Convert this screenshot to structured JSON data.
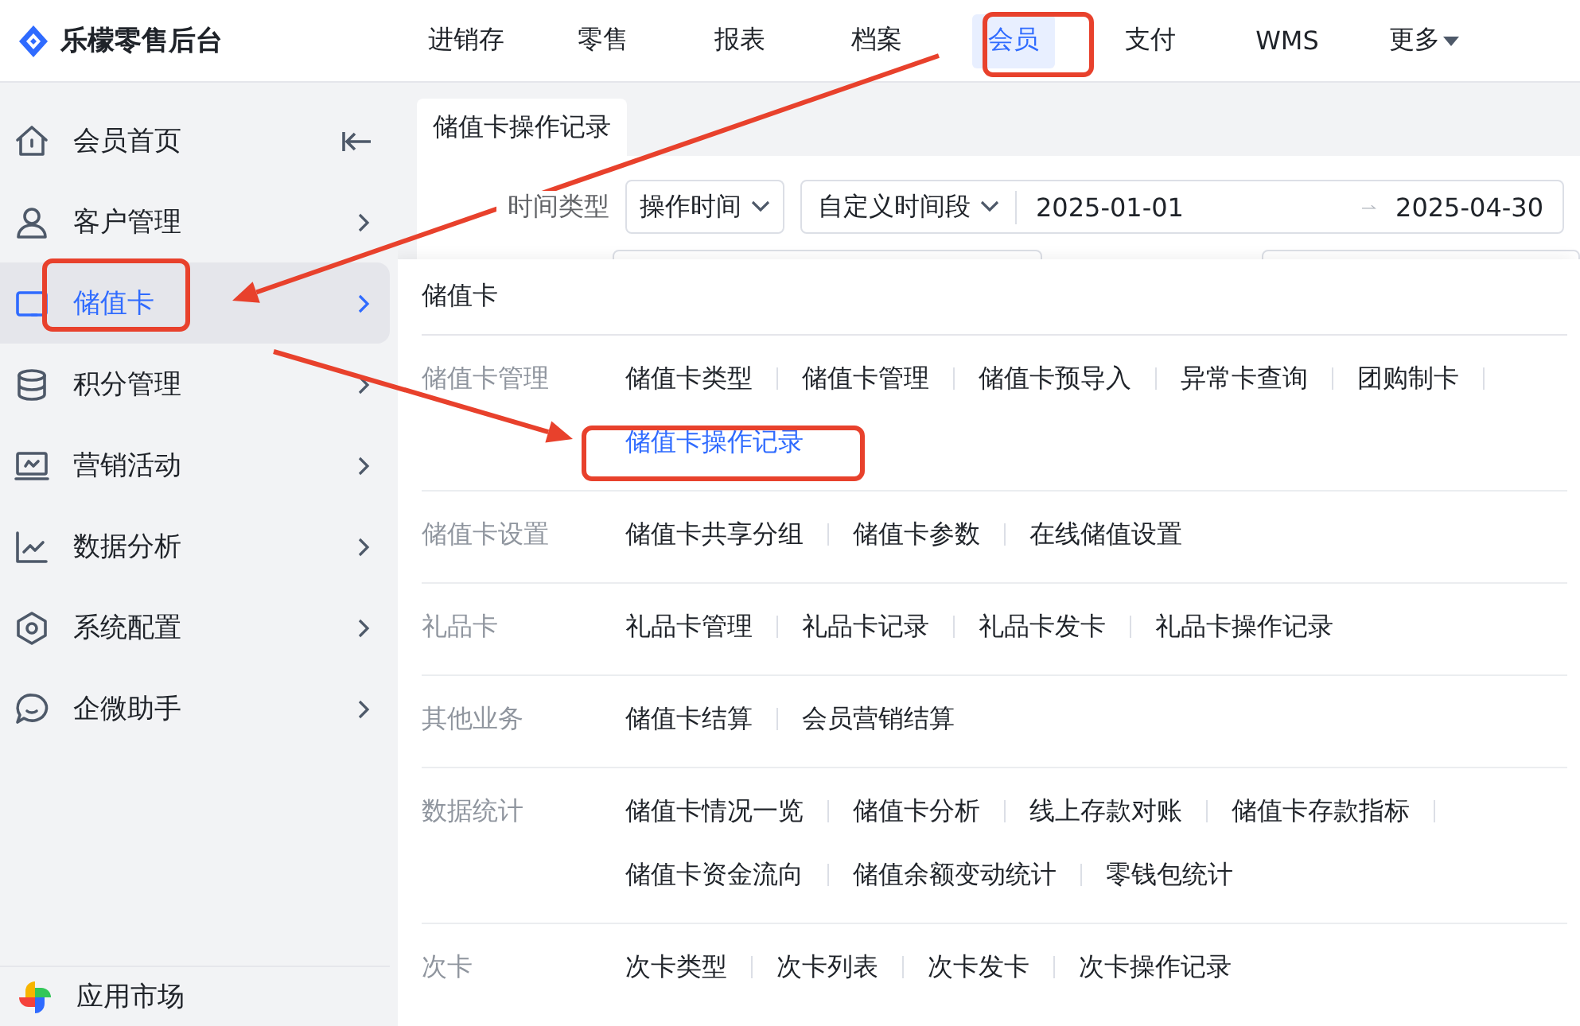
{
  "header": {
    "logo": "乐檬零售后台",
    "nav": [
      {
        "label": "进销存",
        "selected": false,
        "dropdown": false
      },
      {
        "label": "零售",
        "selected": false,
        "dropdown": false
      },
      {
        "label": "报表",
        "selected": false,
        "dropdown": false
      },
      {
        "label": "档案",
        "selected": false,
        "dropdown": false
      },
      {
        "label": "会员",
        "selected": true,
        "dropdown": false
      },
      {
        "label": "支付",
        "selected": false,
        "dropdown": false
      },
      {
        "label": "WMS",
        "selected": false,
        "dropdown": false
      },
      {
        "label": "更多",
        "selected": false,
        "dropdown": true
      }
    ]
  },
  "sidebar": {
    "items": [
      {
        "label": "会员首页",
        "kind": "collapse",
        "selected": false
      },
      {
        "label": "客户管理",
        "kind": "submenu",
        "selected": false
      },
      {
        "label": "储值卡",
        "kind": "submenu",
        "selected": true
      },
      {
        "label": "积分管理",
        "kind": "submenu",
        "selected": false
      },
      {
        "label": "营销活动",
        "kind": "submenu",
        "selected": false
      },
      {
        "label": "数据分析",
        "kind": "submenu",
        "selected": false
      },
      {
        "label": "系统配置",
        "kind": "submenu",
        "selected": false
      },
      {
        "label": "企微助手",
        "kind": "submenu",
        "selected": false
      }
    ],
    "footer": {
      "label": "应用市场"
    }
  },
  "tab": {
    "label": "储值卡操作记录",
    "selected": true
  },
  "filters": {
    "label": "时间类型",
    "time_type": "操作时间",
    "range_mode": "自定义时间段",
    "start_date": "2025-01-01",
    "end_date": "2025-04-30"
  },
  "menu_panel": {
    "title": "储值卡",
    "groups": [
      {
        "label": "储值卡管理",
        "lines": [
          [
            {
              "label": "储值卡类型",
              "selected": false
            },
            {
              "label": "储值卡管理",
              "selected": false
            },
            {
              "label": "储值卡预导入",
              "selected": false
            },
            {
              "label": "异常卡查询",
              "selected": false
            },
            {
              "label": "团购制卡",
              "selected": false
            }
          ],
          [
            {
              "label": "储值卡操作记录",
              "selected": true
            }
          ]
        ]
      },
      {
        "label": "储值卡设置",
        "lines": [
          [
            {
              "label": "储值卡共享分组",
              "selected": false
            },
            {
              "label": "储值卡参数",
              "selected": false
            },
            {
              "label": "在线储值设置",
              "selected": false
            }
          ]
        ]
      },
      {
        "label": "礼品卡",
        "lines": [
          [
            {
              "label": "礼品卡管理",
              "selected": false
            },
            {
              "label": "礼品卡记录",
              "selected": false
            },
            {
              "label": "礼品卡发卡",
              "selected": false
            },
            {
              "label": "礼品卡操作记录",
              "selected": false
            }
          ]
        ]
      },
      {
        "label": "其他业务",
        "lines": [
          [
            {
              "label": "储值卡结算",
              "selected": false
            },
            {
              "label": "会员营销结算",
              "selected": false
            }
          ]
        ]
      },
      {
        "label": "数据统计",
        "lines": [
          [
            {
              "label": "储值卡情况一览",
              "selected": false
            },
            {
              "label": "储值卡分析",
              "selected": false
            },
            {
              "label": "线上存款对账",
              "selected": false
            },
            {
              "label": "储值卡存款指标",
              "selected": false
            }
          ],
          [
            {
              "label": "储值卡资金流向",
              "selected": false
            },
            {
              "label": "储值余额变动统计",
              "selected": false
            },
            {
              "label": "零钱包统计",
              "selected": false
            }
          ]
        ]
      },
      {
        "label": "次卡",
        "lines": [
          [
            {
              "label": "次卡类型",
              "selected": false
            },
            {
              "label": "次卡列表",
              "selected": false
            },
            {
              "label": "次卡发卡",
              "selected": false
            },
            {
              "label": "次卡操作记录",
              "selected": false
            }
          ]
        ]
      }
    ]
  }
}
